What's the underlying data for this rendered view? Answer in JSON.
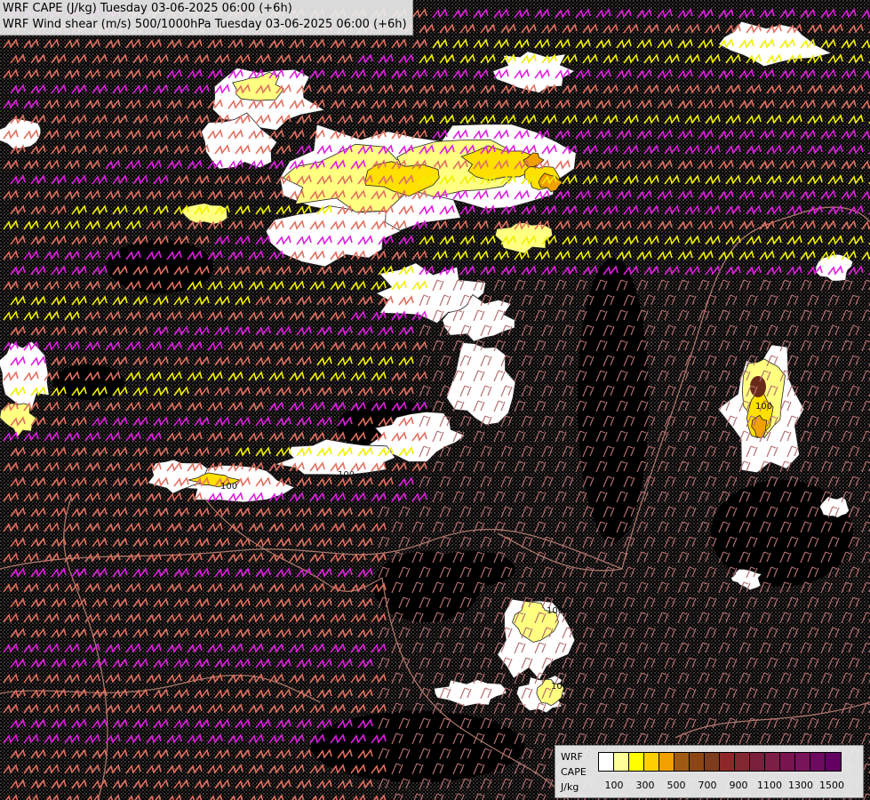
{
  "header": {
    "line1": "WRF CAPE (J/kg) Tuesday 03-06-2025 06:00 (+6h)",
    "line2": "WRF Wind shear (m/s) 500/1000hPa Tuesday 03-06-2025 06:00 (+6h)"
  },
  "legend": {
    "model": "WRF",
    "variable": "CAPE",
    "unit": "J/kg",
    "colors": [
      "#ffffff",
      "#ffff99",
      "#ffff00",
      "#ffd000",
      "#f0a000",
      "#a05a14",
      "#8c4614",
      "#7d3c1e",
      "#8c2828",
      "#822832",
      "#7a203c",
      "#7d1e46",
      "#781450",
      "#78145a",
      "#6e0a5f",
      "#640064"
    ],
    "tick_labels": [
      "100",
      "300",
      "500",
      "700",
      "900",
      "1100",
      "1300",
      "1500"
    ]
  },
  "map": {
    "colors": {
      "background": "#000000",
      "stipple": "#8a7a7a",
      "barb_strong": "#e01ee0",
      "barb_medium": "#e07060",
      "barb_light": "#f0f000",
      "barb_weak": "#b47070",
      "cape_white": "#ffffff",
      "cape_low": "#ffff80",
      "cape_mid": "#ffe000",
      "cape_high": "#f0a000",
      "cape_max": "#6a2a1a",
      "borders": "#d09080"
    },
    "contour_labels": [
      "100",
      "100",
      "100",
      "100",
      "100",
      "100"
    ]
  }
}
